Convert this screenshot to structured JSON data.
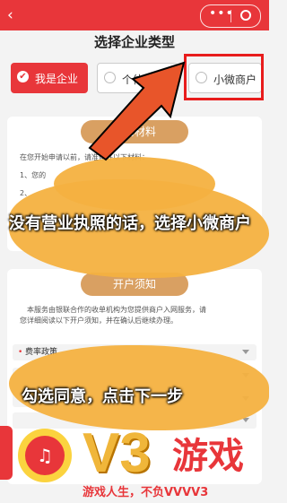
{
  "header": {
    "back_icon": "‹"
  },
  "page_title": "选择企业类型",
  "options": [
    {
      "label": "我是企业",
      "selected": true
    },
    {
      "label": "个体工商户",
      "selected": false
    },
    {
      "label": "小微商户",
      "selected": false
    }
  ],
  "section1": {
    "title_visible": "备的材料",
    "intro": "在您开始申请以前，请准备好以下材料：",
    "item1": "1、您的",
    "item2": "2、"
  },
  "section2": {
    "title": "开户须知",
    "notice_line1": "本服务由银联合作的收单机构为您提供商户入网服务，请",
    "notice_line2": "您详细阅读以下开户须知，并在确认后继续办理。",
    "rows": [
      {
        "label": "费率政策"
      }
    ]
  },
  "annotations": {
    "caption1": "没有营业执照的话，选择小微商户",
    "caption2": "勾选同意，点击下一步"
  },
  "watermark": {
    "logo_text": "V3",
    "brand": "游戏",
    "slogan": "游戏人生，不负VVVV3"
  },
  "colors": {
    "accent": "#e8363a",
    "section_pill": "#d9a062",
    "highlight": "#f4b140"
  }
}
